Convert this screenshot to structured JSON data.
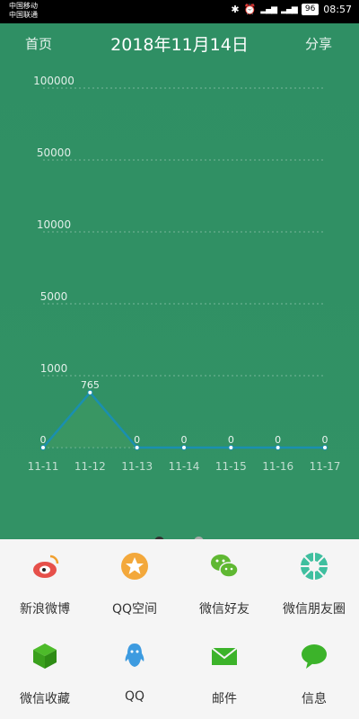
{
  "status": {
    "carrier1": "中国移动",
    "carrier2": "中国联通",
    "battery": "96",
    "time": "08:57"
  },
  "appbar": {
    "home": "首页",
    "title": "2018年11月14日",
    "share": "分享"
  },
  "chart_data": {
    "type": "line",
    "yticks": [
      "100000",
      "50000",
      "10000",
      "5000",
      "1000"
    ],
    "x": [
      "11-11",
      "11-12",
      "11-13",
      "11-14",
      "11-15",
      "11-16",
      "11-17"
    ],
    "values": [
      0,
      765,
      0,
      0,
      0,
      0,
      0
    ],
    "data_labels": [
      "0",
      "765",
      "0",
      "0",
      "0",
      "0",
      "0"
    ],
    "y_scale": "non-linear",
    "grid": true,
    "line_color": "#1a8fb0"
  },
  "share_items": [
    {
      "label": "新浪微博",
      "icon": "weibo-icon"
    },
    {
      "label": "QQ空间",
      "icon": "qzone-icon"
    },
    {
      "label": "微信好友",
      "icon": "wechat-icon"
    },
    {
      "label": "微信朋友圈",
      "icon": "moments-icon"
    },
    {
      "label": "微信收藏",
      "icon": "wechat-favorites-icon"
    },
    {
      "label": "QQ",
      "icon": "qq-icon"
    },
    {
      "label": "邮件",
      "icon": "mail-icon"
    },
    {
      "label": "信息",
      "icon": "message-icon"
    }
  ],
  "colors": {
    "background": "#2f8f64",
    "panel": "#f5f5f5"
  }
}
